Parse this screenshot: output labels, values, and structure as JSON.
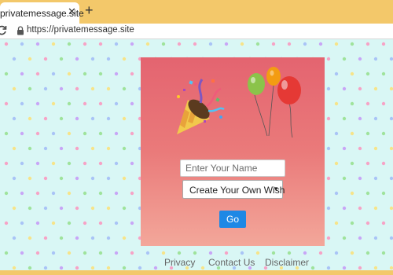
{
  "browser": {
    "tab_title": "privatemessage.site",
    "close_glyph": "✕",
    "new_tab_glyph": "+",
    "url": "https://privatemessage.site"
  },
  "form": {
    "name_placeholder": "Enter Your Name",
    "wish_selected": "Create Your Own Wish",
    "go_label": "Go"
  },
  "footer": {
    "privacy": "Privacy",
    "contact": "Contact Us",
    "disclaimer": "Disclaimer"
  },
  "colors": {
    "chrome": "#f3c86a",
    "page_bg": "#d9f7f5",
    "card_top": "#e46470",
    "card_bottom": "#f3a79a",
    "button": "#1e88e5"
  },
  "icons": {
    "reload": "reload-icon",
    "lock": "lock-icon",
    "party": "party-popper-icon",
    "balloons": "balloons-icon"
  }
}
